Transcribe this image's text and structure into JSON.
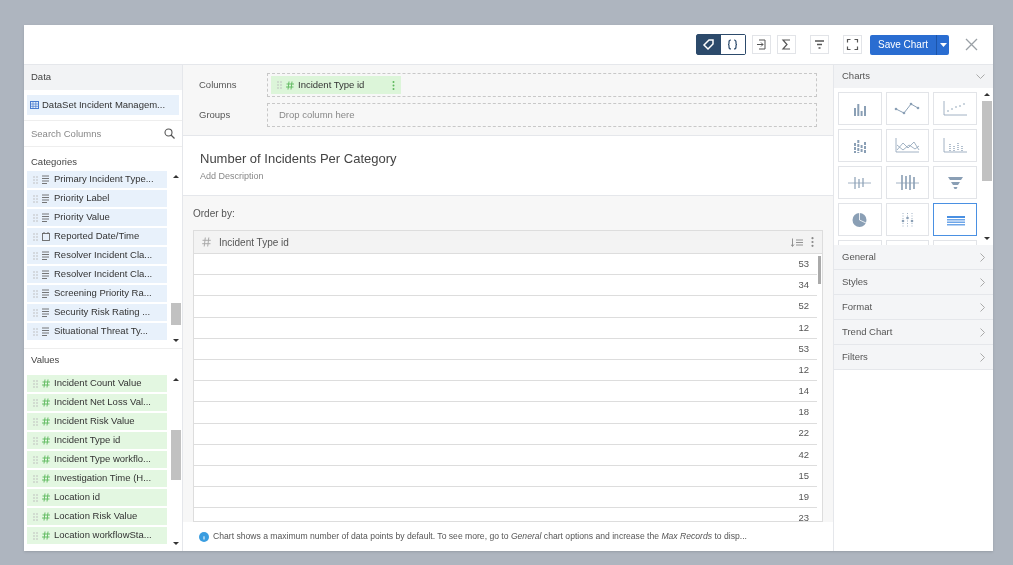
{
  "toolbar": {
    "toggles": [
      {
        "kind": "tag",
        "selected": true
      },
      {
        "kind": "code",
        "selected": false
      }
    ],
    "tools": [
      {
        "kind": "export"
      },
      {
        "kind": "sum"
      },
      {
        "kind": "filter"
      },
      {
        "kind": "fullscreen"
      }
    ],
    "save_button": "Save Chart"
  },
  "data_panel": {
    "title": "Data",
    "dataset": "DataSet Incident Managem...",
    "search": {
      "placeholder": "Search Columns"
    },
    "categories": {
      "title": "Categories",
      "items": [
        {
          "label": "Primary Incident Type...",
          "kind": "text"
        },
        {
          "label": "Priority Label",
          "kind": "text"
        },
        {
          "label": "Priority Value",
          "kind": "text"
        },
        {
          "label": "Reported Date/Time",
          "kind": "date"
        },
        {
          "label": "Resolver Incident Cla...",
          "kind": "text"
        },
        {
          "label": "Resolver Incident Cla...",
          "kind": "text"
        },
        {
          "label": "Screening Priority Ra...",
          "kind": "text"
        },
        {
          "label": "Security Risk Rating ...",
          "kind": "text"
        },
        {
          "label": "Situational Threat Ty...",
          "kind": "text"
        }
      ]
    },
    "values": {
      "title": "Values",
      "items": [
        {
          "label": "Incident Count Value"
        },
        {
          "label": "Incident Net Loss Val..."
        },
        {
          "label": "Incident Risk Value"
        },
        {
          "label": "Incident Type id"
        },
        {
          "label": "Incident Type workflo..."
        },
        {
          "label": "Investigation Time (H..."
        },
        {
          "label": "Location id"
        },
        {
          "label": "Location Risk Value"
        },
        {
          "label": "Location workflowSta..."
        }
      ]
    }
  },
  "builder": {
    "columns_label": "Columns",
    "columns": [
      {
        "label": "Incident Type id"
      }
    ],
    "groups_label": "Groups",
    "groups_placeholder": "Drop column here",
    "chart_title": "Number of Incidents Per Category",
    "description_placeholder": "Add Description",
    "order_by": "Order by:",
    "table": {
      "column": "Incident Type id",
      "rows": [
        "53",
        "34",
        "52",
        "12",
        "53",
        "12",
        "14",
        "18",
        "22",
        "42",
        "15",
        "19",
        "23"
      ]
    },
    "notice": "Chart shows a maximum number of data points by default. To see more, go to *General* chart options and increase the *Max Records* to disp..."
  },
  "charts_panel": {
    "title": "Charts",
    "types": [
      {
        "kind": "bar",
        "selected": false
      },
      {
        "kind": "line",
        "selected": false
      },
      {
        "kind": "scatter",
        "selected": false
      },
      {
        "kind": "stacked-bar",
        "selected": false
      },
      {
        "kind": "area",
        "selected": false
      },
      {
        "kind": "dot-column",
        "selected": false
      },
      {
        "kind": "candlestick",
        "selected": false
      },
      {
        "kind": "box",
        "selected": false
      },
      {
        "kind": "funnel",
        "selected": false
      },
      {
        "kind": "pie",
        "selected": false
      },
      {
        "kind": "dot-plot",
        "selected": false
      },
      {
        "kind": "table",
        "selected": true
      }
    ],
    "sections": [
      "General",
      "Styles",
      "Format",
      "Trend Chart",
      "Filters"
    ]
  }
}
